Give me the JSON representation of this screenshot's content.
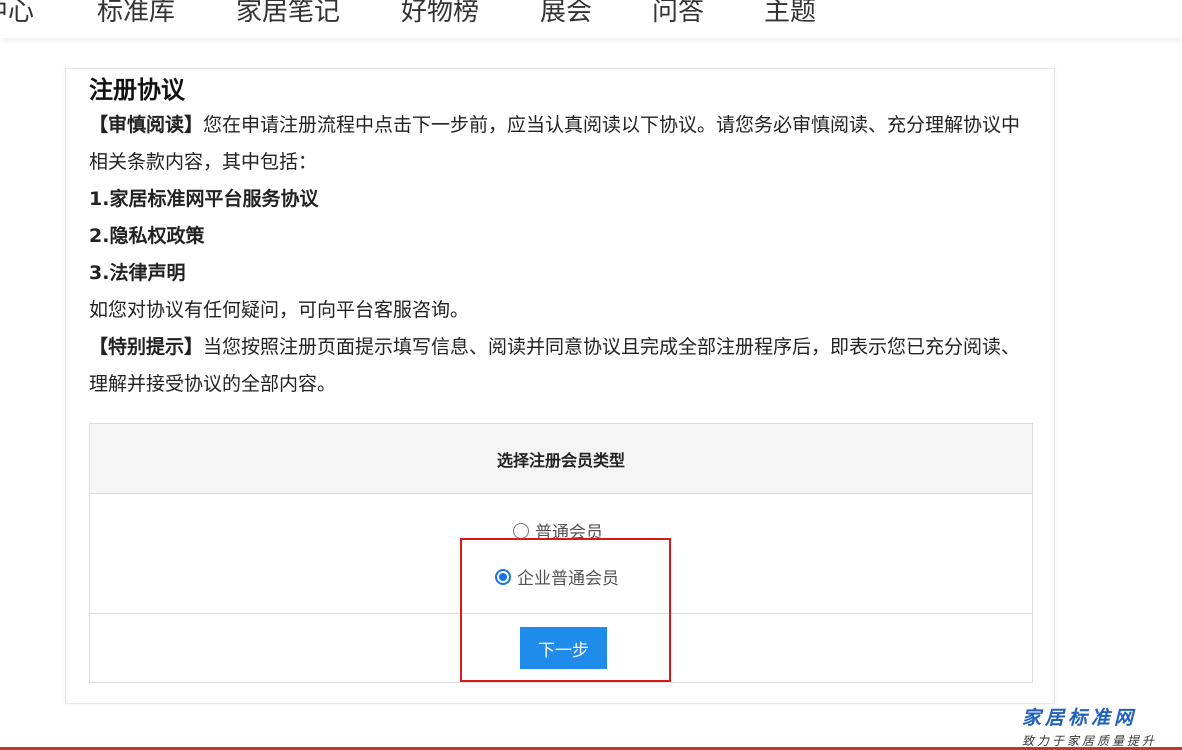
{
  "nav": {
    "items": [
      {
        "id": "center",
        "label": "中心"
      },
      {
        "id": "standards",
        "label": "标准库"
      },
      {
        "id": "notes",
        "label": "家居笔记"
      },
      {
        "id": "ranking",
        "label": "好物榜"
      },
      {
        "id": "expo",
        "label": "展会"
      },
      {
        "id": "qa",
        "label": "问答"
      },
      {
        "id": "topics",
        "label": "主题"
      }
    ]
  },
  "agreement": {
    "title": "注册协议",
    "caution_label": "【审慎阅读】",
    "caution_text": "您在申请注册流程中点击下一步前，应当认真阅读以下协议。请您务必审慎阅读、充分理解协议中相关条款内容，其中包括：",
    "item1": "1.家居标准网平台服务协议",
    "item2": "2.隐私权政策",
    "item3": "3.法律声明",
    "inquiry": "如您对协议有任何疑问，可向平台客服咨询。",
    "notice_label": "【特别提示】",
    "notice_text": "当您按照注册页面提示填写信息、阅读并同意协议且完成全部注册程序后，即表示您已充分阅读、理解并接受协议的全部内容。"
  },
  "member_type": {
    "header": "选择注册会员类型",
    "options": [
      {
        "label": "普通会员",
        "checked": false
      },
      {
        "label": "企业普通会员",
        "checked": true
      }
    ],
    "next_label": "下一步"
  },
  "watermark": {
    "main": "家居标准网",
    "sub": "致力于家居质量提升"
  },
  "colors": {
    "accent": "#1f8ceb",
    "highlight": "#d7191c",
    "watermark": "#1f5fbf"
  }
}
